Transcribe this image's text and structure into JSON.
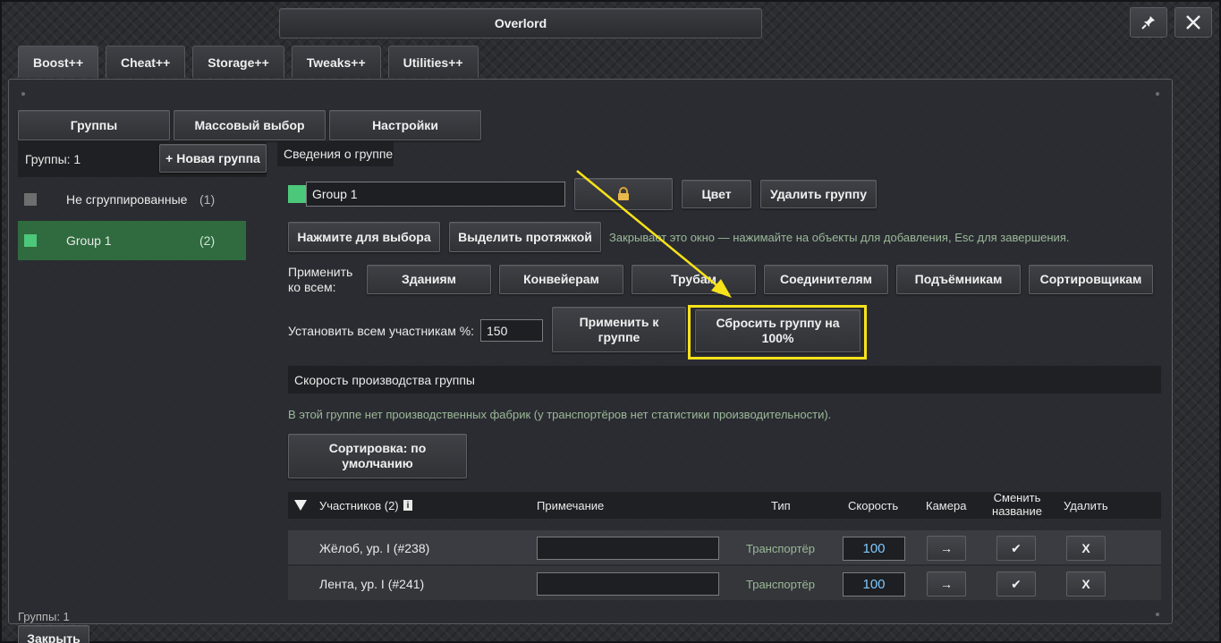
{
  "window": {
    "title": "Overlord",
    "pin_icon": "pin-icon",
    "close_icon": "close-icon"
  },
  "tabs": [
    {
      "label": "Boost++",
      "active": true
    },
    {
      "label": "Cheat++",
      "active": false
    },
    {
      "label": "Storage++",
      "active": false
    },
    {
      "label": "Tweaks++",
      "active": false
    },
    {
      "label": "Utilities++",
      "active": false
    }
  ],
  "subtabs": [
    "Группы",
    "Массовый выбор",
    "Настройки"
  ],
  "sidebar": {
    "count_label": "Группы: 1",
    "new_group_button": "+ Новая группа",
    "groups": [
      {
        "name": "Не сгруппированные",
        "count": "(1)",
        "color": "#6e6e6e",
        "selected": false
      },
      {
        "name": "Group 1",
        "count": "(2)",
        "color": "#4cc87a",
        "selected": true
      }
    ],
    "footer_count": "Группы: 1",
    "close_button": "Закрыть"
  },
  "details": {
    "header": "Сведения о группе",
    "group_name_value": "Group 1",
    "group_color": "#4cc87a",
    "lock_icon": "lock-icon",
    "color_button": "Цвет",
    "delete_button": "Удалить группу",
    "click_select_button": "Нажмите для выбора",
    "drag_select_button": "Выделить протяжкой",
    "select_hint": "Закрывает это окно — нажимайте на объекты для добавления, Esc для завершения.",
    "apply_all_label": "Применить ко всем:",
    "apply_targets": [
      "Зданиям",
      "Конвейерам",
      "Трубам",
      "Соединителям",
      "Подъёмникам",
      "Сортировщикам"
    ],
    "set_all_label": "Установить всем участникам %:",
    "set_all_value": "150",
    "apply_group_button": "Применить к группе",
    "reset_group_button": "Сбросить группу на 100%",
    "production_header": "Скорость производства группы",
    "production_hint": "В этой группе нет производственных фабрик (у транспортёров нет статистики производительности).",
    "sort_button": "Сортировка: по умолчанию"
  },
  "table": {
    "headers": {
      "members": "Участников (2)",
      "note": "Примечание",
      "type": "Тип",
      "speed": "Скорость",
      "camera": "Камера",
      "rename": "Сменить название",
      "delete": "Удалить"
    },
    "rows": [
      {
        "name": "Жёлоб, ур. I (#238)",
        "note": "",
        "type": "Транспортёр",
        "speed": "100",
        "camera": "→",
        "rename": "✔",
        "delete": "X"
      },
      {
        "name": "Лента, ур. I (#241)",
        "note": "",
        "type": "Транспортёр",
        "speed": "100",
        "camera": "→",
        "rename": "✔",
        "delete": "X"
      }
    ]
  },
  "annotation": {
    "color": "#f7e21b"
  }
}
